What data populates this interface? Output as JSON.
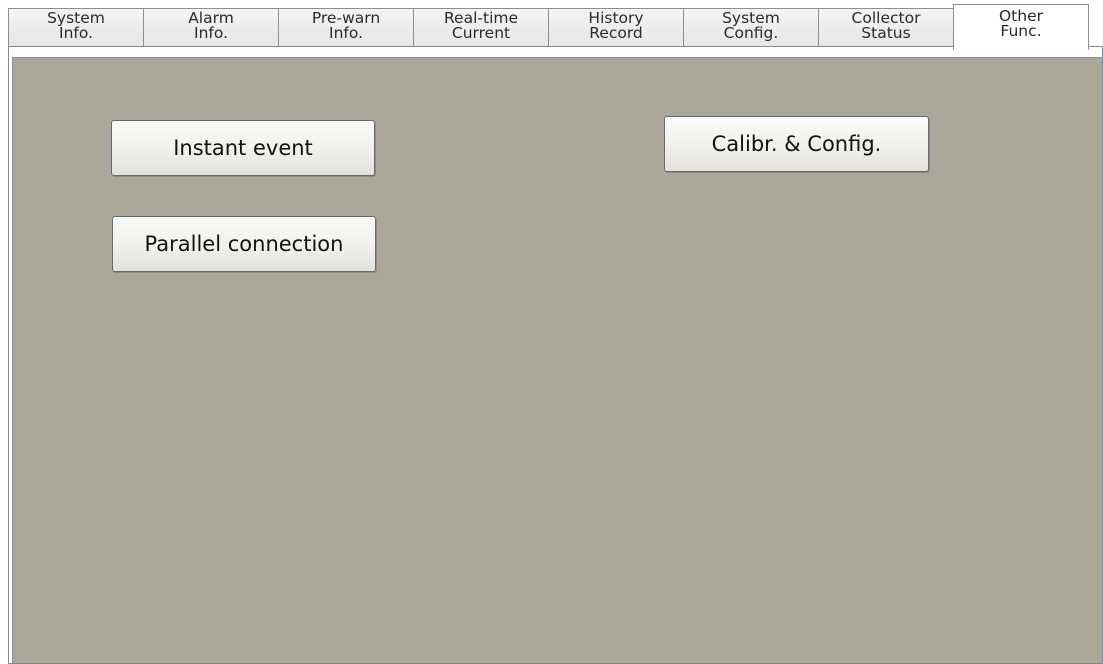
{
  "tabs": [
    {
      "line1": "System",
      "line2": "Info.",
      "active": false
    },
    {
      "line1": "Alarm",
      "line2": "Info.",
      "active": false
    },
    {
      "line1": "Pre-warn",
      "line2": "Info.",
      "active": false
    },
    {
      "line1": "Real-time",
      "line2": "Current",
      "active": false
    },
    {
      "line1": "History",
      "line2": "Record",
      "active": false
    },
    {
      "line1": "System",
      "line2": "Config.",
      "active": false
    },
    {
      "line1": "Collector",
      "line2": "Status",
      "active": false
    },
    {
      "line1": "Other",
      "line2": "Func.",
      "active": true
    }
  ],
  "main": {
    "buttons": {
      "instant_event": "Instant event",
      "parallel_connection": "Parallel connection",
      "calibr_config": "Calibr. & Config."
    }
  },
  "colors": {
    "panel_background": "#aba899",
    "tab_active_background": "#ffffff",
    "tab_inactive_background": "#ececec"
  }
}
